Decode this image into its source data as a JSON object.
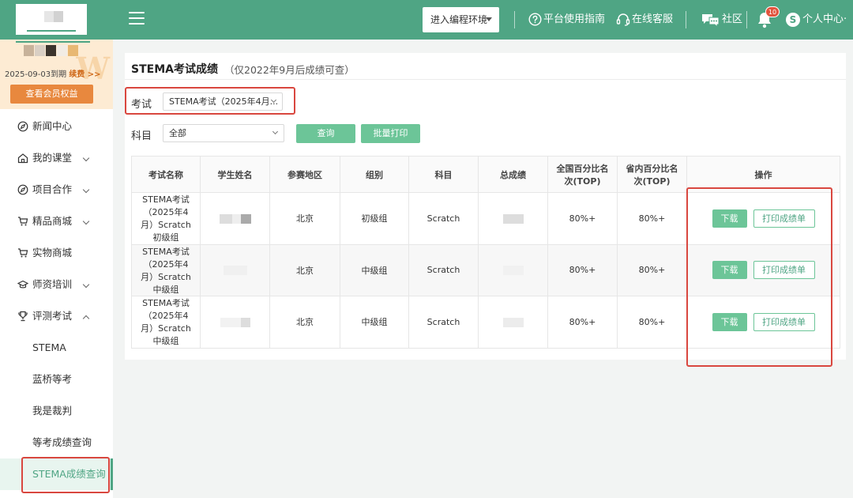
{
  "topbar": {
    "env_button": "进入编程环境",
    "guide": "平台使用指南",
    "service": "在线客服",
    "community": "社区",
    "notification_count": "10",
    "avatar_letter": "S",
    "personal_center": "个人中心·"
  },
  "sidebar": {
    "expire_date": "2025-09-03到期",
    "renew": "续费 >>",
    "rights_button": "查看会员权益",
    "watermark": "W",
    "menu": [
      {
        "label": "新闻中心",
        "icon": "compass-icon"
      },
      {
        "label": "我的课堂",
        "icon": "home-icon"
      },
      {
        "label": "项目合作",
        "icon": "compass-icon"
      },
      {
        "label": "精品商城",
        "icon": "cart-icon"
      },
      {
        "label": "实物商城",
        "icon": "cart-icon"
      },
      {
        "label": "师资培训",
        "icon": "graduation-cap-icon"
      },
      {
        "label": "评测考试",
        "icon": "trophy-icon"
      }
    ],
    "submenu": [
      "STEMA",
      "蓝桥等考",
      "我是裁判",
      "等考成绩查询",
      "STEMA成绩查询"
    ]
  },
  "main": {
    "title": "STEMA考试成绩",
    "note": "（仅2022年9月后成绩可查）",
    "exam_label": "考试",
    "exam_value": "STEMA考试（2025年4月...",
    "subject_label": "科目",
    "subject_value": "全部",
    "query_button": "查询",
    "batch_print_button": "批量打印",
    "table": {
      "headers": [
        "考试名称",
        "学生姓名",
        "参赛地区",
        "组别",
        "科目",
        "总成绩",
        "全国百分比名次(TOP)",
        "省内百分比名次(TOP)",
        "操作"
      ],
      "rows": [
        {
          "exam": "STEMA考试（2025年4月）Scratch初级组",
          "region": "北京",
          "group": "初级组",
          "subject": "Scratch",
          "national": "80%+",
          "province": "80%+"
        },
        {
          "exam": "STEMA考试（2025年4月）Scratch中级组",
          "region": "北京",
          "group": "中级组",
          "subject": "Scratch",
          "national": "80%+",
          "province": "80%+"
        },
        {
          "exam": "STEMA考试（2025年4月）Scratch中级组",
          "region": "北京",
          "group": "中级组",
          "subject": "Scratch",
          "national": "80%+",
          "province": "80%+"
        }
      ],
      "download_label": "下载",
      "print_label": "打印成绩单"
    }
  },
  "colors": {
    "brand": "#4fa584",
    "button_green": "#6cc598",
    "orange": "#e8883e",
    "highlight_red": "#d9473f"
  }
}
